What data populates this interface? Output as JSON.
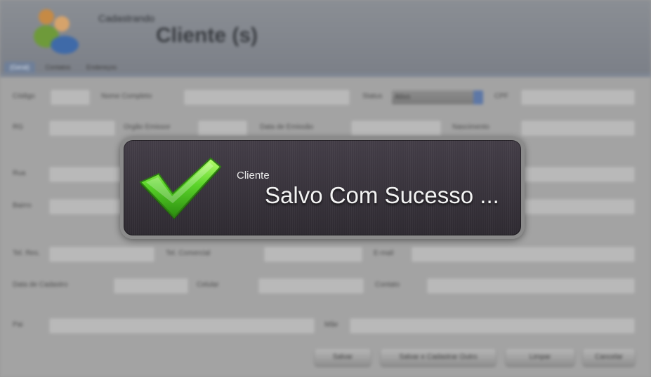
{
  "header": {
    "subtitle": "Cadastrando",
    "title": "Cliente (s)",
    "tabs": [
      "(Geral)",
      "Contatos",
      "Endereços"
    ]
  },
  "form": {
    "codigo_label": "Código",
    "nome_label": "Nome Completo",
    "status_label": "Status",
    "status_value": "Ativo",
    "cpf_label": "CPF",
    "rg_label": "RG",
    "orgao_label": "Orgão Emissor",
    "data_emissao_label": "Data de Emissão",
    "nascimento_label": "Nascimento",
    "rua_label": "Rua",
    "bairro_label": "Bairro",
    "tel_label": "Tel. Res.",
    "tel2_label": "Tel. Comercial",
    "email_label": "E-mail",
    "data_cadastro_label": "Data de Cadastro",
    "celular_label": "Celular",
    "contato_label": "Contato",
    "pai_label": "Pai",
    "mae_label": "Mãe",
    "buttons": [
      "Salvar",
      "Salvar e Cadastrar Outro",
      "Limpar",
      "Cancelar"
    ]
  },
  "notification": {
    "caption": "Cliente",
    "message": "Salvo Com Sucesso ...",
    "icon": "checkmark-icon",
    "accent": "#5bd42a"
  }
}
